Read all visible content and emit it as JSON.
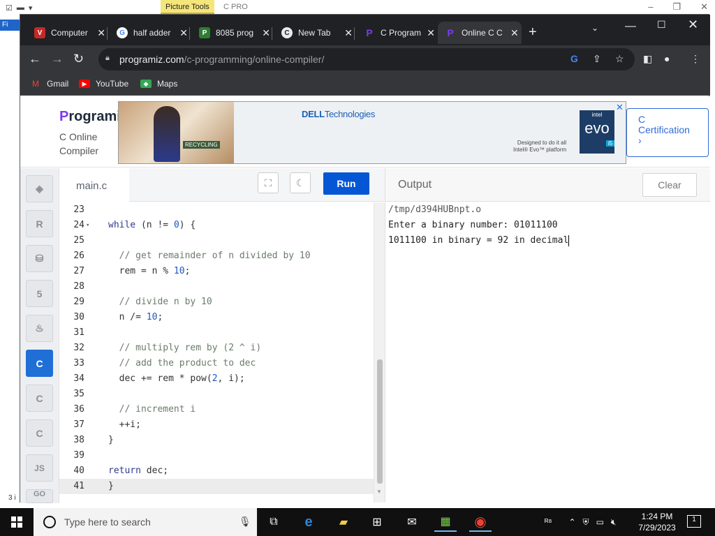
{
  "background_window": {
    "picture_tools": "Picture Tools",
    "title": "C PRO",
    "file_tab": "Fi",
    "status_fragment": "3 i"
  },
  "browser": {
    "tabs": [
      {
        "title": "Computer",
        "favicon": "V",
        "color": "#c62828"
      },
      {
        "title": "half adder",
        "favicon": "G",
        "color": "#ffffff"
      },
      {
        "title": "8085 prog",
        "favicon": "P",
        "color": "#2e7d32"
      },
      {
        "title": "New Tab",
        "favicon": "C",
        "color": "#5f6368"
      },
      {
        "title": "C Program",
        "favicon": "P",
        "color": "#7a3bf0"
      },
      {
        "title": "Online C C",
        "favicon": "P",
        "color": "#7a3bf0",
        "active": true
      }
    ],
    "url_domain": "programiz.com",
    "url_path": "/c-programming/online-compiler/",
    "bookmarks": [
      "Gmail",
      "YouTube",
      "Maps"
    ]
  },
  "site": {
    "logo": "Programiz",
    "logo_initial": "P",
    "logo_rest": "rogramiz",
    "subtitle_line1": "C Online",
    "subtitle_line2": "Compiler",
    "ad": {
      "brand": "DELL",
      "brand_suffix": "Technologies",
      "recycle": "RECYCLING",
      "fine1": "Designed to do it all",
      "fine2": "Intel® Evo™ platform",
      "evo_top": "intel",
      "evo_mid": "evo",
      "evo_badge": "i5"
    },
    "cert_line1": "C",
    "cert_line2": "Certification",
    "cert_arrow": "›"
  },
  "sidebar": {
    "languages": [
      "python",
      "r",
      "sql",
      "html",
      "java",
      "c",
      "cpp",
      "csharp",
      "js",
      "go"
    ],
    "active": "c",
    "js_label": "JS",
    "go_label": "GO"
  },
  "editor": {
    "filename": "main.c",
    "run_label": "Run",
    "lines": [
      {
        "n": "23",
        "code": ""
      },
      {
        "n": "24",
        "fold": true,
        "code": "while (n != 0) {"
      },
      {
        "n": "25",
        "code": ""
      },
      {
        "n": "26",
        "code": "  // get remainder of n divided by 10"
      },
      {
        "n": "27",
        "code": "  rem = n % 10;"
      },
      {
        "n": "28",
        "code": ""
      },
      {
        "n": "29",
        "code": "  // divide n by 10"
      },
      {
        "n": "30",
        "code": "  n /= 10;"
      },
      {
        "n": "31",
        "code": ""
      },
      {
        "n": "32",
        "code": "  // multiply rem by (2 ^ i)"
      },
      {
        "n": "33",
        "code": "  // add the product to dec"
      },
      {
        "n": "34",
        "code": "  dec += rem * pow(2, i);"
      },
      {
        "n": "35",
        "code": ""
      },
      {
        "n": "36",
        "code": "  // increment i"
      },
      {
        "n": "37",
        "code": "  ++i;"
      },
      {
        "n": "38",
        "code": "}"
      },
      {
        "n": "39",
        "code": ""
      },
      {
        "n": "40",
        "code": "return dec;"
      },
      {
        "n": "41",
        "code": "}"
      }
    ],
    "current_line": 41
  },
  "output": {
    "label": "Output",
    "clear_label": "Clear",
    "lines": [
      "/tmp/d394HUBnpt.o",
      "Enter a binary number: 01011100",
      "1011100 in binary = 92 in decimal"
    ]
  },
  "taskbar": {
    "search_placeholder": "Type here to search",
    "time": "1:24 PM",
    "date": "7/29/2023",
    "notifications": "1"
  }
}
